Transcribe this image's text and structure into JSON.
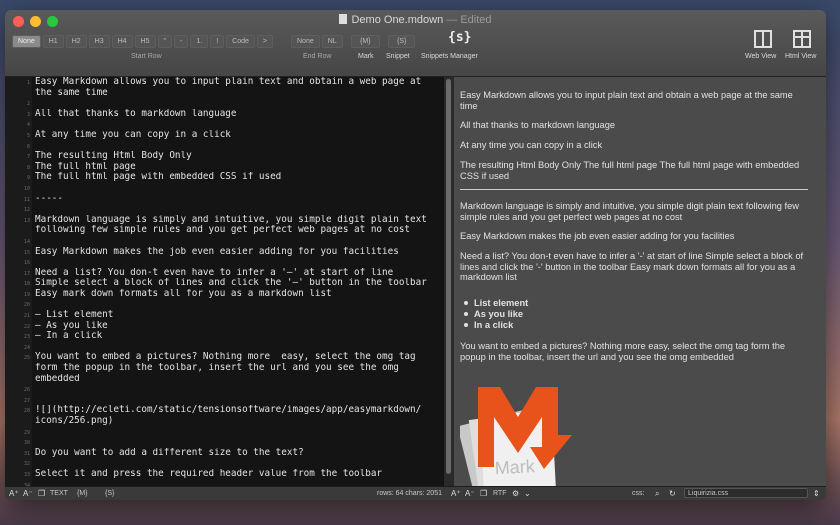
{
  "window": {
    "title": "Demo One.mdown",
    "edited": "— Edited",
    "colors": {
      "close": "#fe5f57",
      "minimize": "#febc2e",
      "zoom": "#28c840",
      "editor_bg": "#141414",
      "preview_bg": "#4b4b4b"
    }
  },
  "toolbar": {
    "start_row": [
      "None",
      "H1",
      "H2",
      "H3",
      "H4",
      "H5",
      "\"",
      "-",
      "1.",
      "!",
      "Code",
      ">"
    ],
    "start_row_selected": "None",
    "start_row_label": "Start Row",
    "end_row": [
      "None",
      "NL"
    ],
    "end_row_label": "End Row",
    "mark": "{M}",
    "mark_label": "Mark",
    "snippet": "{S}",
    "snippet_label": "Snippet",
    "snippets_manager_icon": "{s}",
    "snippets_manager_label": "Snippets Manager",
    "web_view_label": "Web View",
    "html_view_label": "Html View"
  },
  "editor": {
    "lines": [
      {
        "n": "1",
        "t": "Easy Markdown allows you to input plain text and obtain a web page at"
      },
      {
        "n": "",
        "t": "the same time"
      },
      {
        "n": "2",
        "t": ""
      },
      {
        "n": "3",
        "t": "All that thanks to markdown language"
      },
      {
        "n": "4",
        "t": ""
      },
      {
        "n": "5",
        "t": "At any time you can copy in a click"
      },
      {
        "n": "6",
        "t": ""
      },
      {
        "n": "7",
        "t": "The resulting Html Body Only"
      },
      {
        "n": "8",
        "t": "The full html page"
      },
      {
        "n": "9",
        "t": "The full html page with embedded CSS if used"
      },
      {
        "n": "10",
        "t": ""
      },
      {
        "n": "11",
        "t": "-----"
      },
      {
        "n": "12",
        "t": ""
      },
      {
        "n": "13",
        "t": "Markdown language is simply and intuitive, you simple digit plain text"
      },
      {
        "n": "",
        "t": "following few simple rules and you get perfect web pages at no cost"
      },
      {
        "n": "14",
        "t": ""
      },
      {
        "n": "15",
        "t": "Easy Markdown makes the job even easier adding for you facilities"
      },
      {
        "n": "16",
        "t": ""
      },
      {
        "n": "17",
        "t": "Need a list? You don-t even have to infer a '–' at start of line"
      },
      {
        "n": "18",
        "t": "Simple select a block of lines and click the '–' button in the toolbar"
      },
      {
        "n": "19",
        "t": "Easy mark down formats all for you as a markdown list"
      },
      {
        "n": "20",
        "t": ""
      },
      {
        "n": "21",
        "t": "– List element"
      },
      {
        "n": "22",
        "t": "– As you like"
      },
      {
        "n": "23",
        "t": "– In a click"
      },
      {
        "n": "24",
        "t": ""
      },
      {
        "n": "25",
        "t": "You want to embed a pictures? Nothing more  easy, select the omg tag"
      },
      {
        "n": "",
        "t": "form the popup in the toolbar, insert the url and you see the omg"
      },
      {
        "n": "",
        "t": "embedded"
      },
      {
        "n": "26",
        "t": ""
      },
      {
        "n": "27",
        "t": ""
      },
      {
        "n": "28",
        "t": "![](http://ecleti.com/static/tensionsoftware/images/app/easymarkdown/"
      },
      {
        "n": "",
        "t": "icons/256.png)"
      },
      {
        "n": "29",
        "t": ""
      },
      {
        "n": "30",
        "t": ""
      },
      {
        "n": "31",
        "t": "Do you want to add a different size to the text?"
      },
      {
        "n": "32",
        "t": ""
      },
      {
        "n": "33",
        "t": "Select it and press the required header value from the toolbar"
      },
      {
        "n": "34",
        "t": ""
      },
      {
        "n": "35",
        "t": ""
      }
    ]
  },
  "preview": {
    "p1": "Easy Markdown allows you to input plain text and obtain a web page at the same time",
    "p2": "All that thanks to markdown language",
    "p3": "At any time you can copy in a click",
    "p4": "The resulting Html Body Only The full html page The full html page with embedded CSS if used",
    "p5": "Markdown language is simply and intuitive, you simple digit plain text following few simple rules and you get perfect web pages at no cost",
    "p6": "Easy Markdown makes the job even easier adding for you facilities",
    "p7": "Need a list? You don-t even have to infer a '-' at start of line Simple select a block of lines and click the '-' button in the toolbar Easy mark down formats all for you as a markdown list",
    "list": [
      "List element",
      "As you like",
      "In a click"
    ],
    "p8": "You want to embed a pictures? Nothing more easy, select the omg tag form the popup in the toolbar, insert the url and you see the omg embedded",
    "image_icon": "easymarkdown-logo-icon",
    "image_text": "Mark"
  },
  "status": {
    "text_label": "TEXT",
    "mark": "{M}",
    "snippet": "{S}",
    "counts": "rows: 64 chars: 2051",
    "rtf_label": "RTF",
    "css_label": "css:",
    "css_value": "Liquirizia.css"
  }
}
